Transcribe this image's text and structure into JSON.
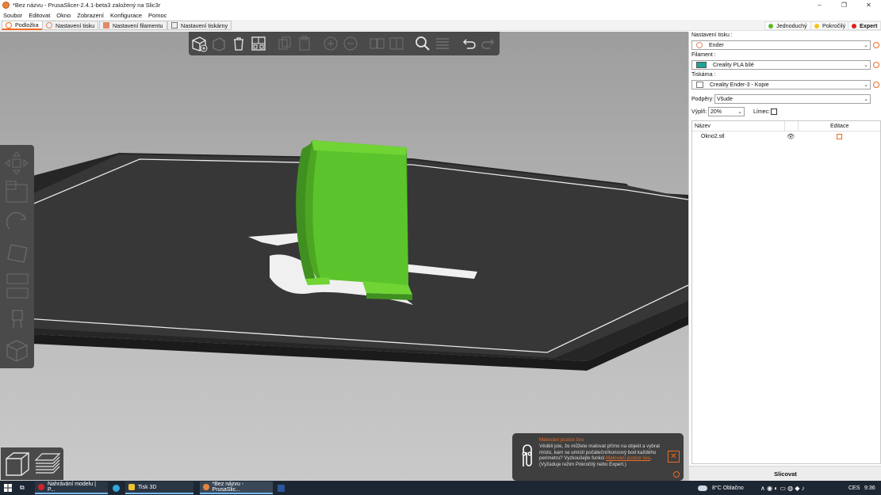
{
  "window": {
    "title": "*Bez názvu - PrusaSlicer-2.4.1-beta3 založený na Slic3r",
    "controls": [
      "–",
      "❐",
      "✕"
    ]
  },
  "menu": [
    "Soubor",
    "Editovat",
    "Okno",
    "Zobrazení",
    "Konfigurace",
    "Pomoc"
  ],
  "tabs": [
    "Podložka",
    "Nastavení tisku",
    "Nastavení filamentu",
    "Nastavení tiskárny"
  ],
  "modes": {
    "simple": "Jednoduchý",
    "advanced": "Pokročilý",
    "expert": "Expert",
    "colors": {
      "simple": "#5cb82c",
      "advanced": "#f5c518",
      "expert": "#e11d1d"
    }
  },
  "sidebar": {
    "print_label": "Nastavení tisku :",
    "print_value": "Ender",
    "filament_label": "Filament :",
    "filament_value": "Creality PLA bílé",
    "filament_color": "#1fa29a",
    "printer_label": "Tiskárna :",
    "printer_value": "Creality Ender-3 - Kopie",
    "supports_label": "Podpěry:",
    "supports_value": "Všude",
    "infill_label": "Výplň:",
    "infill_value": "20%",
    "brim_label": "Límec:",
    "objects": {
      "col_name": "Název",
      "col_edit": "Editace",
      "items": [
        {
          "name": "Okno2.stl"
        }
      ]
    },
    "slice_button": "Slicovat"
  },
  "hint": {
    "title": "Malování pozice švu",
    "text": "Věděli jste, že můžete malovat přímo na objekt a vybrat místo, kam se umístí počáteční/koncový bod každého perimetru? Vyzkoušejte funkci",
    "link": "Malování pozice švu",
    "suffix": ". (Vyžaduje režim Pokročilý nebo Expert.)"
  },
  "taskbar": {
    "apps": [
      "Nahrávání modelu | P...",
      "Tisk 3D",
      "*Bez názvu - PrusaSlic..."
    ],
    "weather": "8°C  Oblačno",
    "lang": "CES",
    "time": "9:36"
  },
  "colors": {
    "accent": "#ed6b21",
    "model": "#5bc42c",
    "bed": "#3a3a3a"
  }
}
